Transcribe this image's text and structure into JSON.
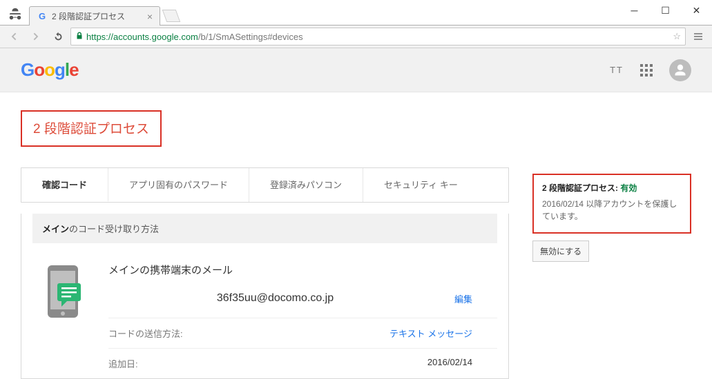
{
  "window": {
    "tab_title": "2 段階認証プロセス"
  },
  "addressbar": {
    "secure_host": "https://accounts.google.com",
    "path_tail": "/b/1/SmASettings#devices"
  },
  "gbar": {
    "tt_label": "TT"
  },
  "page": {
    "title": "2 段階認証プロセス",
    "tabs": {
      "codes": "確認コード",
      "app_passwords": "アプリ固有のパスワード",
      "registered_pcs": "登録済みパソコン",
      "security_key": "セキュリティ キー"
    },
    "panel_header_bold": "メイン",
    "panel_header_rest": "のコード受け取り方法",
    "device_title": "メインの携帯端末のメール",
    "email_value": "36f35uu@docomo.co.jp",
    "edit_label": "編集",
    "rows": {
      "send_method_label": "コードの送信方法:",
      "send_method_value": "テキスト メッセージ",
      "added_label": "追加日:",
      "added_value": "2016/02/14"
    }
  },
  "side": {
    "title_prefix": "2 段階認証プロセス: ",
    "status_word": "有効",
    "since_text": "2016/02/14 以降アカウントを保護しています。",
    "disable_button": "無効にする"
  }
}
